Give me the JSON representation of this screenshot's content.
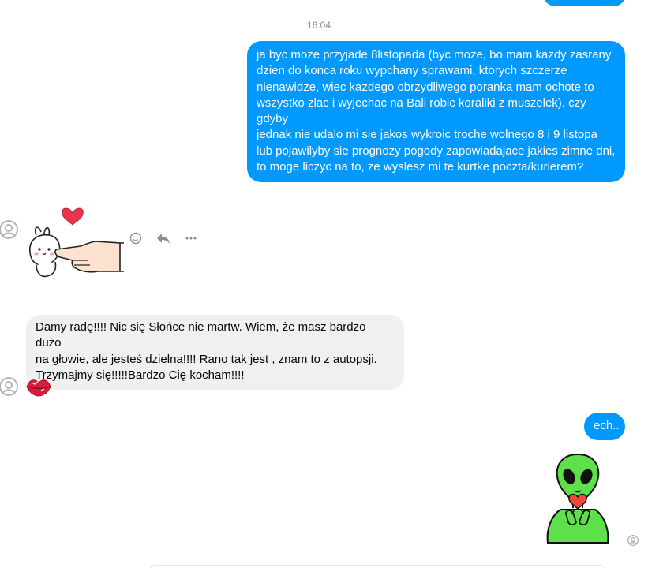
{
  "conversation": {
    "timestamp": "16:04",
    "messages": [
      {
        "id": "msg-outgoing-long",
        "text": "ja byc moze przyjade 8listopada (byc moze, bo mam kazdy zasrany\ndzien do konca roku wypchany sprawami, ktorych szczerze\nnienawidze, wiec kazdego obrzydliwego poranka mam ochote to\nwszystko zlac i wyjechac na Bali robic koraliki z muszelek). czy gdyby\njednak nie udalo mi sie jakos wykroic troche wolnego 8 i 9 listopa\nlub pojawilyby sie prognozy pogody zapowiadajace jakies zimne dni,\nto moge liczyc na to, ze wyslesz mi te kurtke poczta/kurierem?"
      },
      {
        "id": "msg-incoming-polish",
        "text": "Damy radę!!!! Nic się Słońce nie martw. Wiem, że masz bardzo dużo\nna głowie, ale jesteś dzielna!!!! Rano tak jest , znam to z autopsji.\nTrzymajmy się!!!!!Bardzo Cię kocham!!!!"
      },
      {
        "id": "msg-outgoing-short",
        "text": "ech.."
      }
    ],
    "stickers": {
      "incoming": "bunny-poke-heart-sticker",
      "outgoing": "green-alien-heart-sticker",
      "reaction": "red-lips-emoji"
    },
    "message_actions": [
      "react-icon",
      "reply-icon",
      "more-icon"
    ]
  },
  "colors": {
    "outgoing_bubble": "#0099ff",
    "incoming_bubble": "#f0f0f0",
    "timestamp_text": "#8a8d91"
  }
}
